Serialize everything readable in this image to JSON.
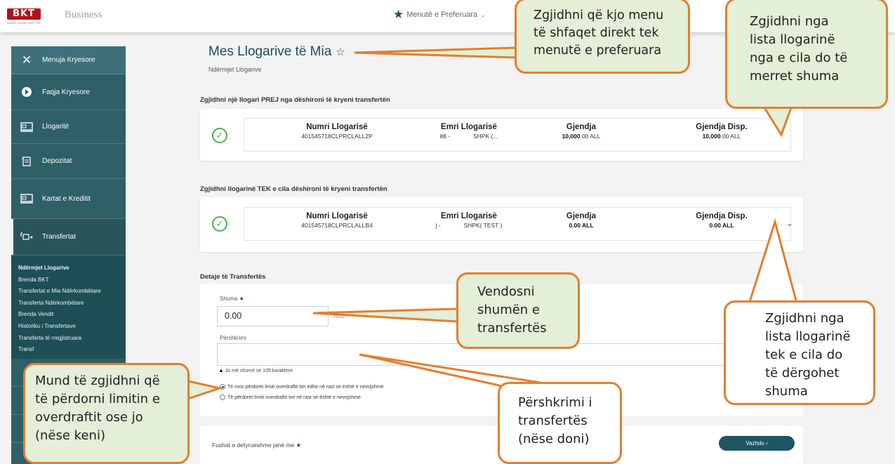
{
  "header": {
    "logo_text": "BKT",
    "logo_tagline": "BANKA KOMBETARE TREGTARE",
    "brand_sub": "Business",
    "favorite_menu": "Menutë e Preferuara"
  },
  "sidebar": {
    "items": [
      {
        "label": "Menuja Kryesore",
        "icon": "close-icon"
      },
      {
        "label": "Faqja Kryesore",
        "icon": "home-icon"
      },
      {
        "label": "Llogaritë",
        "icon": "accounts-icon"
      },
      {
        "label": "Depozitat",
        "icon": "deposit-icon"
      },
      {
        "label": "Kartat e Kreditit",
        "icon": "card-icon"
      },
      {
        "label": "Transfertat",
        "icon": "transfer-icon"
      }
    ],
    "submenu": [
      "Ndërmjet Llogarive",
      "Brenda BKT",
      "Transfertat e Mia Ndërkombëtare",
      "Transferta Ndërkombëtare",
      "Brenda Vendit",
      "Historiku i Transfertave",
      "Transferta të rregjistruara",
      "Transf"
    ]
  },
  "page": {
    "title": "Mes Llogarive të Mia",
    "subtitle": "Ndërmjet Llogarive"
  },
  "from_section": {
    "label": "Zgjidhni një llogari PREJ nga dëshironi të kryeni transfertën",
    "headers": [
      "Numri Llogarisë",
      "Emri Llogarisë",
      "Gjendja",
      "Gjendja Disp."
    ],
    "account_number": "401545718CLPRCLALL2P",
    "name_prefix": "88 -",
    "name_suffix": "SHPK (...",
    "balance_bold": "10,000",
    "balance_rest": ".00 ALL",
    "avail_bold": "10,000",
    "avail_rest": ".00 ALL"
  },
  "to_section": {
    "label": "Zgjidhni llogarinë TEK e cila dëshironi të kryeni transfertën",
    "headers": [
      "Numri Llogarisë",
      "Emri Llogarisë",
      "Gjendja",
      "Gjendja Disp."
    ],
    "account_number": "401545718CLPRCLALLB4",
    "name_prefix": "j -",
    "name_suffix": "SHPK( TEST )",
    "balance": "0.00 ALL",
    "avail": "0.00 ALL"
  },
  "details": {
    "title": "Detaje të Transfertës",
    "amount_label": "Shuma",
    "amount_value": "0.00",
    "currency": "ALL",
    "description_label": "Përshkrimi",
    "warning": "Jo më shumë se 105 karaktere",
    "radio_1": "Të mos përdoret limiti overdraftit tim edhe në rast se është e nevojshme",
    "radio_2": "Të përdoret limiti overdraftit tim në rast se është e nevojshme",
    "selected_radio": 1
  },
  "footer": {
    "required_note": "Fushat e detyrueshme janë me",
    "next_button": "Vazhdo ›"
  },
  "callouts": {
    "favorite": [
      "Zgjidhni që kjo menu",
      "të shfaqet direkt tek",
      "menutë e preferuara"
    ],
    "from_account": [
      "Zgjidhni nga",
      "lista llogarinë",
      "nga e cila do të",
      "merret shuma"
    ],
    "to_account": [
      "Zgjidhni nga",
      "lista llogarinë",
      "tek e cila do",
      "të dërgohet",
      "shuma"
    ],
    "amount": [
      "Vendosni",
      "shumën e",
      "transfertës"
    ],
    "overdraft": [
      "Mund të zgjidhni që",
      "të përdorni limitin e",
      "overdraftit ose jo",
      "(nëse keni)"
    ],
    "description": [
      "Përshkrimi i",
      "transfertës",
      "(nëse doni)"
    ]
  },
  "colors": {
    "sidebar": "#2f5f67",
    "accent": "#1e5561",
    "callout_border": "#e27f2e",
    "callout_fill": "#e3efd6",
    "check": "#4caf50"
  }
}
